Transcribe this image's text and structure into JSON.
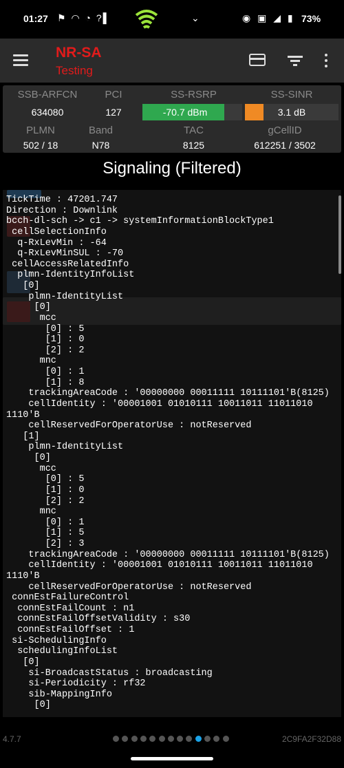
{
  "status_bar": {
    "time": "01:27",
    "left_icons": "⚑ ◠ ◔ ?▌",
    "right_icons": "◉ ▣ ◢ ▮",
    "battery": "73%"
  },
  "app_bar": {
    "title": "NR-SA",
    "subtitle": "Testing",
    "icons": [
      "menu-icon",
      "card-icon",
      "filter-icon",
      "more-vert-icon"
    ]
  },
  "stats": {
    "headers": [
      "SSB-ARFCN",
      "PCI",
      "SS-RSRP",
      "SS-SINR"
    ],
    "values": {
      "ssb_arfcn": "634080",
      "pci": "127",
      "rsrp": "-70.7 dBm",
      "sinr": "3.1 dB"
    },
    "rsrp_level": 0.82,
    "sinr_level": 0.2,
    "headers2": [
      "PLMN",
      "Band",
      "TAC",
      "gCellID"
    ],
    "values2": {
      "plmn": "502 / 18",
      "band": "N78",
      "tac": "8125",
      "gcellid": "612251 / 3502"
    },
    "colors": {
      "rsrp": "#2fa84f",
      "sinr": "#f08a24"
    }
  },
  "signaling": {
    "title": "Signaling (Filtered)",
    "log": "TickTime : 47201.747\nDirection : Downlink\nbcch-dl-sch -> c1 -> systemInformationBlockType1\n cellSelectionInfo\n  q-RxLevMin : -64\n  q-RxLevMinSUL : -70\n cellAccessRelatedInfo\n  plmn-IdentityInfoList\n   [0]\n    plmn-IdentityList\n     [0]\n      mcc\n       [0] : 5\n       [1] : 0\n       [2] : 2\n      mnc\n       [0] : 1\n       [1] : 8\n    trackingAreaCode : '00000000 00011111 10111101'B(8125)\n    cellIdentity : '00001001 01010111 10011011 11011010\n1110'B\n    cellReservedForOperatorUse : notReserved\n   [1]\n    plmn-IdentityList\n     [0]\n      mcc\n       [0] : 5\n       [1] : 0\n       [2] : 2\n      mnc\n       [0] : 1\n       [1] : 5\n       [2] : 3\n    trackingAreaCode : '00000000 00011111 10111101'B(8125)\n    cellIdentity : '00001001 01010111 10011011 11011010\n1110'B\n    cellReservedForOperatorUse : notReserved\n connEstFailureControl\n  connEstFailCount : n1\n  connEstFailOffsetValidity : s30\n  connEstFailOffset : 1\n si-SchedulingInfo\n  schedulingInfoList\n   [0]\n    si-BroadcastStatus : broadcasting\n    si-Periodicity : rf32\n    sib-MappingInfo\n     [0]"
  },
  "footer": {
    "version": "4.7.7",
    "device_id": "2C9FA2F32D88",
    "page_count": 13,
    "active_page_index": 9,
    "active_color": "#1aa3e8"
  }
}
